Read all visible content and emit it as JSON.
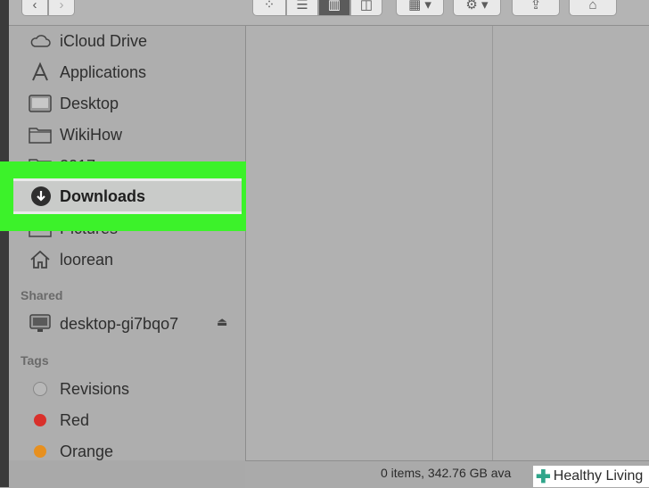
{
  "toolbar": {
    "back_icon": "chevron-left-icon",
    "forward_icon": "chevron-right-icon",
    "view_modes": [
      "icon-view",
      "list-view",
      "column-view",
      "cover-flow-view"
    ],
    "active_view": "column-view",
    "arrange_icon": "grid-arrange-icon",
    "action_icon": "gear-icon",
    "share_icon": "share-icon",
    "tag_icon": "tag-icon"
  },
  "sidebar": {
    "favorites": [
      {
        "label": "iCloud Drive",
        "icon": "cloud-icon"
      },
      {
        "label": "Applications",
        "icon": "applications-icon"
      },
      {
        "label": "Desktop",
        "icon": "desktop-icon"
      },
      {
        "label": "WikiHow",
        "icon": "folder-icon"
      },
      {
        "label": "2017",
        "icon": "folder-icon"
      },
      {
        "label": "Downloads",
        "icon": "downloads-icon"
      },
      {
        "label": "Pictures",
        "icon": "pictures-icon"
      },
      {
        "label": "loorean",
        "icon": "home-icon"
      }
    ],
    "shared_header": "Shared",
    "shared": [
      {
        "label": "desktop-gi7bqo7",
        "icon": "monitor-icon",
        "eject_icon": "eject-icon"
      }
    ],
    "tags_header": "Tags",
    "tags": [
      {
        "label": "Revisions",
        "color": "#b8b8b8"
      },
      {
        "label": "Red",
        "color": "#d9302b"
      },
      {
        "label": "Orange",
        "color": "#e7901f"
      }
    ],
    "highlight_color": "#3cf22a"
  },
  "status": {
    "text": "0 items, 342.76 GB ava"
  },
  "watermark": {
    "text": "Healthy Living"
  }
}
